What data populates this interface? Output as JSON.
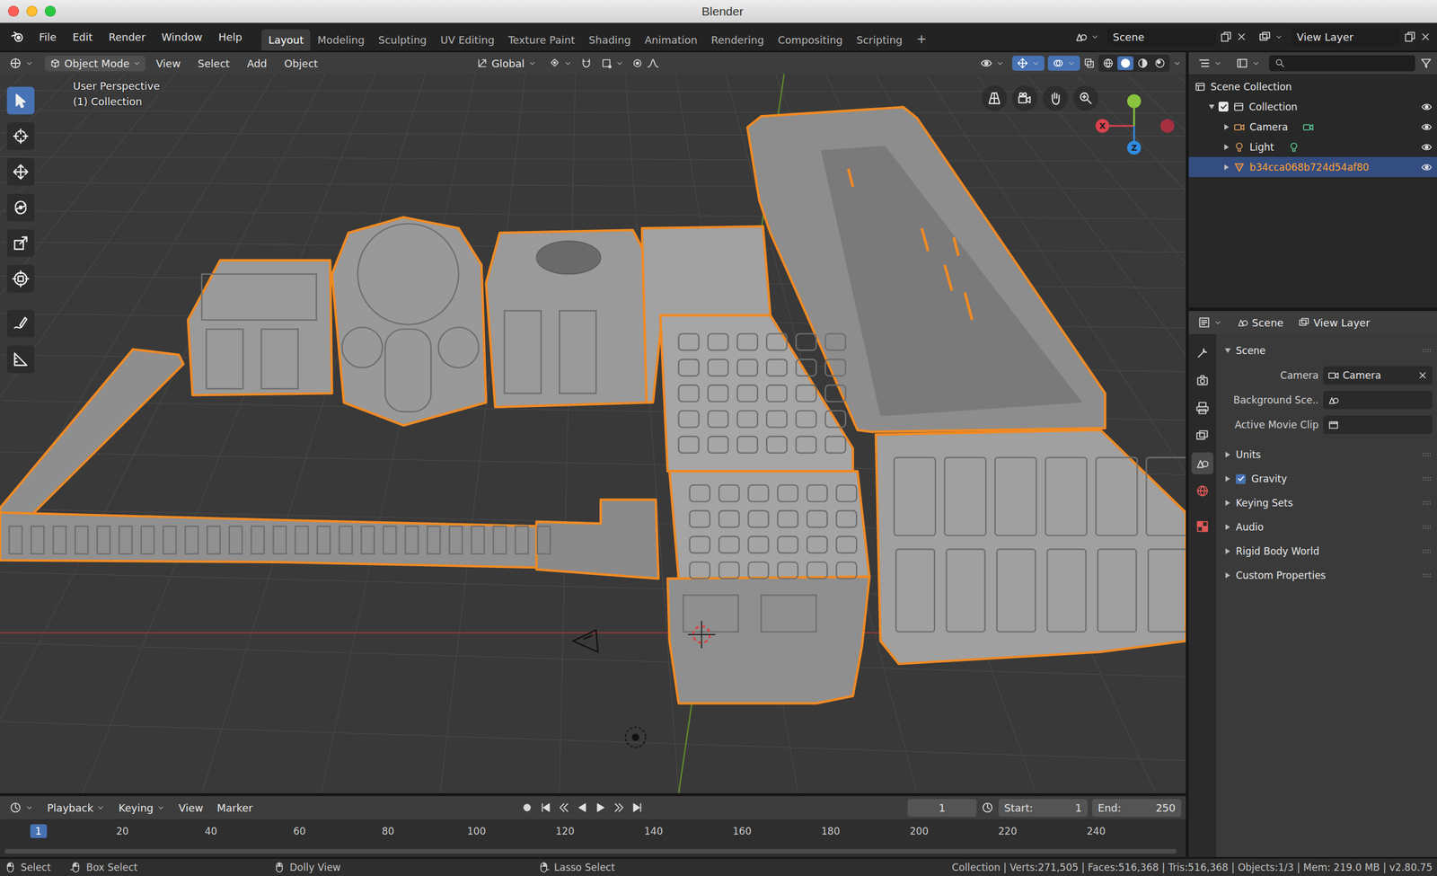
{
  "window": {
    "title": "Blender"
  },
  "menus": [
    "File",
    "Edit",
    "Render",
    "Window",
    "Help"
  ],
  "workspaces": [
    {
      "label": "Layout",
      "selected": true
    },
    {
      "label": "Modeling",
      "selected": false
    },
    {
      "label": "Sculpting",
      "selected": false
    },
    {
      "label": "UV Editing",
      "selected": false
    },
    {
      "label": "Texture Paint",
      "selected": false
    },
    {
      "label": "Shading",
      "selected": false
    },
    {
      "label": "Animation",
      "selected": false
    },
    {
      "label": "Rendering",
      "selected": false
    },
    {
      "label": "Compositing",
      "selected": false
    },
    {
      "label": "Scripting",
      "selected": false
    }
  ],
  "add_workspace": "+",
  "scene_selector": {
    "scene": "Scene",
    "view_layer": "View Layer"
  },
  "viewport_header": {
    "mode": "Object Mode",
    "menus": [
      "View",
      "Select",
      "Add",
      "Object"
    ],
    "orientation": "Global"
  },
  "viewport": {
    "view_name": "User Perspective",
    "collection": "(1) Collection",
    "tools": [
      {
        "kind": "select",
        "selected": true
      },
      {
        "kind": "cursor",
        "selected": false
      },
      {
        "kind": "move",
        "selected": false
      },
      {
        "kind": "rotate",
        "selected": false
      },
      {
        "kind": "scale",
        "selected": false
      },
      {
        "kind": "transform",
        "selected": false
      },
      {
        "kind": "annotate",
        "selected": false
      },
      {
        "kind": "measure",
        "selected": false
      }
    ],
    "axes": [
      {
        "label": "X",
        "color": "#d9434f"
      },
      {
        "color": "#8ac43e"
      },
      {
        "label": "Z",
        "color": "#2f8ce0"
      },
      {
        "color": "#a6303f"
      }
    ]
  },
  "outliner": {
    "items": [
      {
        "label": "Scene Collection",
        "kind": "scene_collection",
        "level": 0,
        "selected": false
      },
      {
        "label": "Collection",
        "kind": "collection",
        "level": 1,
        "expanded": true,
        "checked": true,
        "visible": true,
        "selected": false
      },
      {
        "label": "Camera",
        "kind": "camera",
        "level": 2,
        "expanded": false,
        "visible": true,
        "selected": false
      },
      {
        "label": "Light",
        "kind": "light",
        "level": 2,
        "expanded": false,
        "visible": true,
        "selected": false
      },
      {
        "label": "b34cca068b724d54af80",
        "kind": "mesh",
        "level": 2,
        "expanded": false,
        "visible": true,
        "selected": true
      }
    ]
  },
  "properties": {
    "tabs": [
      {
        "label": "Scene",
        "kind": "scene"
      },
      {
        "label": "View Layer",
        "kind": "view_layer"
      }
    ],
    "side_tabs": [
      {
        "kind": "tool",
        "selected": false
      },
      {
        "kind": "render",
        "selected": false
      },
      {
        "kind": "output",
        "selected": false
      },
      {
        "kind": "view_layer",
        "selected": false
      },
      {
        "kind": "scene",
        "selected": true
      },
      {
        "kind": "world",
        "selected": false
      },
      {
        "kind": "texture",
        "selected": false
      }
    ],
    "panel": {
      "title": "Scene",
      "expanded": true,
      "fields": [
        {
          "label": "Camera",
          "value": "Camera",
          "kind": "camera",
          "clearable": true
        },
        {
          "label": "Background Sce..",
          "kind": "scene",
          "clearable": false
        },
        {
          "label": "Active Movie Clip",
          "kind": "clip",
          "clearable": false
        }
      ]
    },
    "subpanels": [
      {
        "label": "Units",
        "kind": "plain",
        "expanded": false
      },
      {
        "label": "Gravity",
        "kind": "checkbox",
        "checked": true,
        "expanded": false
      },
      {
        "label": "Keying Sets",
        "kind": "plain",
        "expanded": false
      },
      {
        "label": "Audio",
        "kind": "plain",
        "expanded": false
      },
      {
        "label": "Rigid Body World",
        "kind": "plain",
        "expanded": false
      },
      {
        "label": "Custom Properties",
        "kind": "plain",
        "expanded": false
      }
    ]
  },
  "timeline": {
    "menus": [
      {
        "label": "Playback",
        "kind": "dropdown"
      },
      {
        "label": "Keying",
        "kind": "dropdown"
      },
      {
        "label": "View",
        "kind": "menu"
      },
      {
        "label": "Marker",
        "kind": "menu"
      }
    ],
    "current_frame": "1",
    "start_label": "Start:",
    "start": "1",
    "end_label": "End:",
    "end": "250",
    "ruler": [
      {
        "label": "1",
        "selected": true
      },
      {
        "label": "20",
        "selected": false
      },
      {
        "label": "40",
        "selected": false
      },
      {
        "label": "60",
        "selected": false
      },
      {
        "label": "80",
        "selected": false
      },
      {
        "label": "100",
        "selected": false
      },
      {
        "label": "120",
        "selected": false
      },
      {
        "label": "140",
        "selected": false
      },
      {
        "label": "160",
        "selected": false
      },
      {
        "label": "180",
        "selected": false
      },
      {
        "label": "200",
        "selected": false
      },
      {
        "label": "220",
        "selected": false
      },
      {
        "label": "240",
        "selected": false
      }
    ]
  },
  "status_bar": {
    "hints": [
      {
        "label": "Select",
        "kind": "lmb"
      },
      {
        "label": "Box Select",
        "kind": "lmb_drag"
      },
      {
        "label": "Dolly View",
        "kind": "mmb"
      },
      {
        "label": "Lasso Select",
        "kind": "rmb_drag"
      }
    ],
    "stats": "Collection | Verts:271,505 | Faces:516,368 | Tris:516,368 | Objects:1/3 | Mem: 219.0 MB | v2.80.75"
  }
}
